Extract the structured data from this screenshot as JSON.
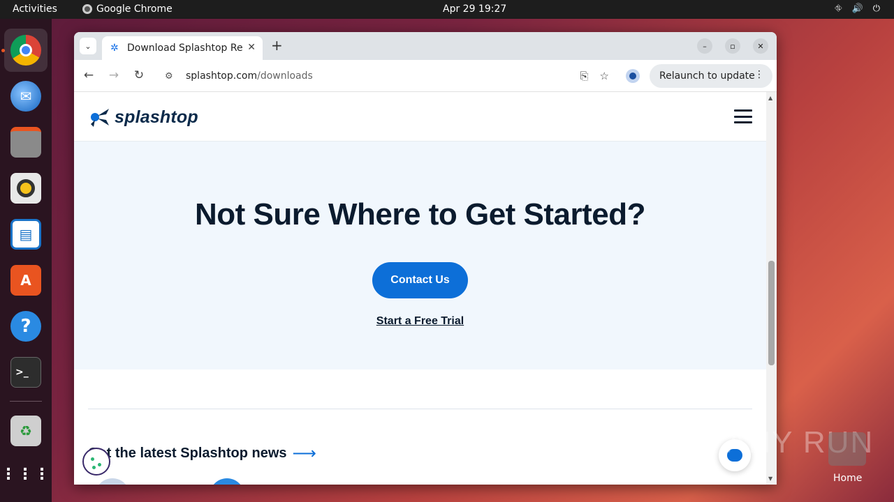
{
  "system": {
    "activities": "Activities",
    "app_name": "Google Chrome",
    "clock": "Apr 29  19:27"
  },
  "browser": {
    "tab_title": "Download Splashtop Re",
    "url_host": "splashtop.com",
    "url_path": "/downloads",
    "relaunch": "Relaunch to update"
  },
  "site": {
    "logo_text": "splashtop",
    "hero_title": "Not Sure Where to Get Started?",
    "contact_button": "Contact Us",
    "trial_link": "Start a Free Trial",
    "news_heading": "Get the latest Splashtop news",
    "accent_color": "#0d6fd8"
  },
  "desktop": {
    "watermark": "ANY RUN",
    "home_label": "Home"
  }
}
